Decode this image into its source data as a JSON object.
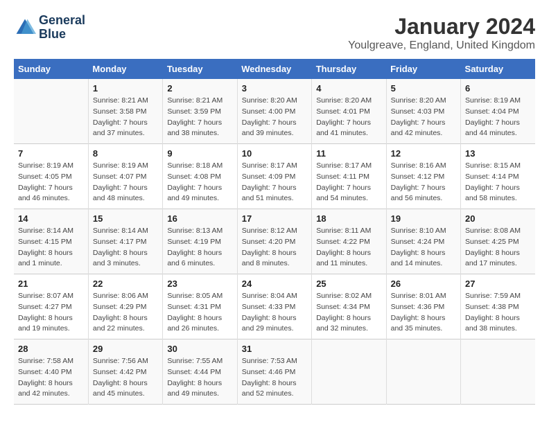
{
  "header": {
    "logo_line1": "General",
    "logo_line2": "Blue",
    "month": "January 2024",
    "location": "Youlgreave, England, United Kingdom"
  },
  "weekdays": [
    "Sunday",
    "Monday",
    "Tuesday",
    "Wednesday",
    "Thursday",
    "Friday",
    "Saturday"
  ],
  "weeks": [
    [
      {
        "day": "",
        "info": ""
      },
      {
        "day": "1",
        "info": "Sunrise: 8:21 AM\nSunset: 3:58 PM\nDaylight: 7 hours\nand 37 minutes."
      },
      {
        "day": "2",
        "info": "Sunrise: 8:21 AM\nSunset: 3:59 PM\nDaylight: 7 hours\nand 38 minutes."
      },
      {
        "day": "3",
        "info": "Sunrise: 8:20 AM\nSunset: 4:00 PM\nDaylight: 7 hours\nand 39 minutes."
      },
      {
        "day": "4",
        "info": "Sunrise: 8:20 AM\nSunset: 4:01 PM\nDaylight: 7 hours\nand 41 minutes."
      },
      {
        "day": "5",
        "info": "Sunrise: 8:20 AM\nSunset: 4:03 PM\nDaylight: 7 hours\nand 42 minutes."
      },
      {
        "day": "6",
        "info": "Sunrise: 8:19 AM\nSunset: 4:04 PM\nDaylight: 7 hours\nand 44 minutes."
      }
    ],
    [
      {
        "day": "7",
        "info": "Sunrise: 8:19 AM\nSunset: 4:05 PM\nDaylight: 7 hours\nand 46 minutes."
      },
      {
        "day": "8",
        "info": "Sunrise: 8:19 AM\nSunset: 4:07 PM\nDaylight: 7 hours\nand 48 minutes."
      },
      {
        "day": "9",
        "info": "Sunrise: 8:18 AM\nSunset: 4:08 PM\nDaylight: 7 hours\nand 49 minutes."
      },
      {
        "day": "10",
        "info": "Sunrise: 8:17 AM\nSunset: 4:09 PM\nDaylight: 7 hours\nand 51 minutes."
      },
      {
        "day": "11",
        "info": "Sunrise: 8:17 AM\nSunset: 4:11 PM\nDaylight: 7 hours\nand 54 minutes."
      },
      {
        "day": "12",
        "info": "Sunrise: 8:16 AM\nSunset: 4:12 PM\nDaylight: 7 hours\nand 56 minutes."
      },
      {
        "day": "13",
        "info": "Sunrise: 8:15 AM\nSunset: 4:14 PM\nDaylight: 7 hours\nand 58 minutes."
      }
    ],
    [
      {
        "day": "14",
        "info": "Sunrise: 8:14 AM\nSunset: 4:15 PM\nDaylight: 8 hours\nand 1 minute."
      },
      {
        "day": "15",
        "info": "Sunrise: 8:14 AM\nSunset: 4:17 PM\nDaylight: 8 hours\nand 3 minutes."
      },
      {
        "day": "16",
        "info": "Sunrise: 8:13 AM\nSunset: 4:19 PM\nDaylight: 8 hours\nand 6 minutes."
      },
      {
        "day": "17",
        "info": "Sunrise: 8:12 AM\nSunset: 4:20 PM\nDaylight: 8 hours\nand 8 minutes."
      },
      {
        "day": "18",
        "info": "Sunrise: 8:11 AM\nSunset: 4:22 PM\nDaylight: 8 hours\nand 11 minutes."
      },
      {
        "day": "19",
        "info": "Sunrise: 8:10 AM\nSunset: 4:24 PM\nDaylight: 8 hours\nand 14 minutes."
      },
      {
        "day": "20",
        "info": "Sunrise: 8:08 AM\nSunset: 4:25 PM\nDaylight: 8 hours\nand 17 minutes."
      }
    ],
    [
      {
        "day": "21",
        "info": "Sunrise: 8:07 AM\nSunset: 4:27 PM\nDaylight: 8 hours\nand 19 minutes."
      },
      {
        "day": "22",
        "info": "Sunrise: 8:06 AM\nSunset: 4:29 PM\nDaylight: 8 hours\nand 22 minutes."
      },
      {
        "day": "23",
        "info": "Sunrise: 8:05 AM\nSunset: 4:31 PM\nDaylight: 8 hours\nand 26 minutes."
      },
      {
        "day": "24",
        "info": "Sunrise: 8:04 AM\nSunset: 4:33 PM\nDaylight: 8 hours\nand 29 minutes."
      },
      {
        "day": "25",
        "info": "Sunrise: 8:02 AM\nSunset: 4:34 PM\nDaylight: 8 hours\nand 32 minutes."
      },
      {
        "day": "26",
        "info": "Sunrise: 8:01 AM\nSunset: 4:36 PM\nDaylight: 8 hours\nand 35 minutes."
      },
      {
        "day": "27",
        "info": "Sunrise: 7:59 AM\nSunset: 4:38 PM\nDaylight: 8 hours\nand 38 minutes."
      }
    ],
    [
      {
        "day": "28",
        "info": "Sunrise: 7:58 AM\nSunset: 4:40 PM\nDaylight: 8 hours\nand 42 minutes."
      },
      {
        "day": "29",
        "info": "Sunrise: 7:56 AM\nSunset: 4:42 PM\nDaylight: 8 hours\nand 45 minutes."
      },
      {
        "day": "30",
        "info": "Sunrise: 7:55 AM\nSunset: 4:44 PM\nDaylight: 8 hours\nand 49 minutes."
      },
      {
        "day": "31",
        "info": "Sunrise: 7:53 AM\nSunset: 4:46 PM\nDaylight: 8 hours\nand 52 minutes."
      },
      {
        "day": "",
        "info": ""
      },
      {
        "day": "",
        "info": ""
      },
      {
        "day": "",
        "info": ""
      }
    ]
  ]
}
